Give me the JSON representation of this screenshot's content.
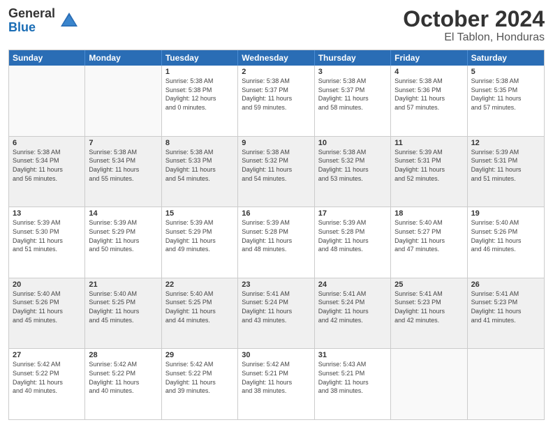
{
  "header": {
    "logo_general": "General",
    "logo_blue": "Blue",
    "month": "October 2024",
    "location": "El Tablon, Honduras"
  },
  "weekdays": [
    "Sunday",
    "Monday",
    "Tuesday",
    "Wednesday",
    "Thursday",
    "Friday",
    "Saturday"
  ],
  "rows": [
    [
      {
        "day": "",
        "info": "",
        "empty": true
      },
      {
        "day": "",
        "info": "",
        "empty": true
      },
      {
        "day": "1",
        "info": "Sunrise: 5:38 AM\nSunset: 5:38 PM\nDaylight: 12 hours\nand 0 minutes."
      },
      {
        "day": "2",
        "info": "Sunrise: 5:38 AM\nSunset: 5:37 PM\nDaylight: 11 hours\nand 59 minutes."
      },
      {
        "day": "3",
        "info": "Sunrise: 5:38 AM\nSunset: 5:37 PM\nDaylight: 11 hours\nand 58 minutes."
      },
      {
        "day": "4",
        "info": "Sunrise: 5:38 AM\nSunset: 5:36 PM\nDaylight: 11 hours\nand 57 minutes."
      },
      {
        "day": "5",
        "info": "Sunrise: 5:38 AM\nSunset: 5:35 PM\nDaylight: 11 hours\nand 57 minutes."
      }
    ],
    [
      {
        "day": "6",
        "info": "Sunrise: 5:38 AM\nSunset: 5:34 PM\nDaylight: 11 hours\nand 56 minutes.",
        "shaded": true
      },
      {
        "day": "7",
        "info": "Sunrise: 5:38 AM\nSunset: 5:34 PM\nDaylight: 11 hours\nand 55 minutes.",
        "shaded": true
      },
      {
        "day": "8",
        "info": "Sunrise: 5:38 AM\nSunset: 5:33 PM\nDaylight: 11 hours\nand 54 minutes.",
        "shaded": true
      },
      {
        "day": "9",
        "info": "Sunrise: 5:38 AM\nSunset: 5:32 PM\nDaylight: 11 hours\nand 54 minutes.",
        "shaded": true
      },
      {
        "day": "10",
        "info": "Sunrise: 5:38 AM\nSunset: 5:32 PM\nDaylight: 11 hours\nand 53 minutes.",
        "shaded": true
      },
      {
        "day": "11",
        "info": "Sunrise: 5:39 AM\nSunset: 5:31 PM\nDaylight: 11 hours\nand 52 minutes.",
        "shaded": true
      },
      {
        "day": "12",
        "info": "Sunrise: 5:39 AM\nSunset: 5:31 PM\nDaylight: 11 hours\nand 51 minutes.",
        "shaded": true
      }
    ],
    [
      {
        "day": "13",
        "info": "Sunrise: 5:39 AM\nSunset: 5:30 PM\nDaylight: 11 hours\nand 51 minutes."
      },
      {
        "day": "14",
        "info": "Sunrise: 5:39 AM\nSunset: 5:29 PM\nDaylight: 11 hours\nand 50 minutes."
      },
      {
        "day": "15",
        "info": "Sunrise: 5:39 AM\nSunset: 5:29 PM\nDaylight: 11 hours\nand 49 minutes."
      },
      {
        "day": "16",
        "info": "Sunrise: 5:39 AM\nSunset: 5:28 PM\nDaylight: 11 hours\nand 48 minutes."
      },
      {
        "day": "17",
        "info": "Sunrise: 5:39 AM\nSunset: 5:28 PM\nDaylight: 11 hours\nand 48 minutes."
      },
      {
        "day": "18",
        "info": "Sunrise: 5:40 AM\nSunset: 5:27 PM\nDaylight: 11 hours\nand 47 minutes."
      },
      {
        "day": "19",
        "info": "Sunrise: 5:40 AM\nSunset: 5:26 PM\nDaylight: 11 hours\nand 46 minutes."
      }
    ],
    [
      {
        "day": "20",
        "info": "Sunrise: 5:40 AM\nSunset: 5:26 PM\nDaylight: 11 hours\nand 45 minutes.",
        "shaded": true
      },
      {
        "day": "21",
        "info": "Sunrise: 5:40 AM\nSunset: 5:25 PM\nDaylight: 11 hours\nand 45 minutes.",
        "shaded": true
      },
      {
        "day": "22",
        "info": "Sunrise: 5:40 AM\nSunset: 5:25 PM\nDaylight: 11 hours\nand 44 minutes.",
        "shaded": true
      },
      {
        "day": "23",
        "info": "Sunrise: 5:41 AM\nSunset: 5:24 PM\nDaylight: 11 hours\nand 43 minutes.",
        "shaded": true
      },
      {
        "day": "24",
        "info": "Sunrise: 5:41 AM\nSunset: 5:24 PM\nDaylight: 11 hours\nand 42 minutes.",
        "shaded": true
      },
      {
        "day": "25",
        "info": "Sunrise: 5:41 AM\nSunset: 5:23 PM\nDaylight: 11 hours\nand 42 minutes.",
        "shaded": true
      },
      {
        "day": "26",
        "info": "Sunrise: 5:41 AM\nSunset: 5:23 PM\nDaylight: 11 hours\nand 41 minutes.",
        "shaded": true
      }
    ],
    [
      {
        "day": "27",
        "info": "Sunrise: 5:42 AM\nSunset: 5:22 PM\nDaylight: 11 hours\nand 40 minutes."
      },
      {
        "day": "28",
        "info": "Sunrise: 5:42 AM\nSunset: 5:22 PM\nDaylight: 11 hours\nand 40 minutes."
      },
      {
        "day": "29",
        "info": "Sunrise: 5:42 AM\nSunset: 5:22 PM\nDaylight: 11 hours\nand 39 minutes."
      },
      {
        "day": "30",
        "info": "Sunrise: 5:42 AM\nSunset: 5:21 PM\nDaylight: 11 hours\nand 38 minutes."
      },
      {
        "day": "31",
        "info": "Sunrise: 5:43 AM\nSunset: 5:21 PM\nDaylight: 11 hours\nand 38 minutes."
      },
      {
        "day": "",
        "info": "",
        "empty": true
      },
      {
        "day": "",
        "info": "",
        "empty": true
      }
    ]
  ]
}
